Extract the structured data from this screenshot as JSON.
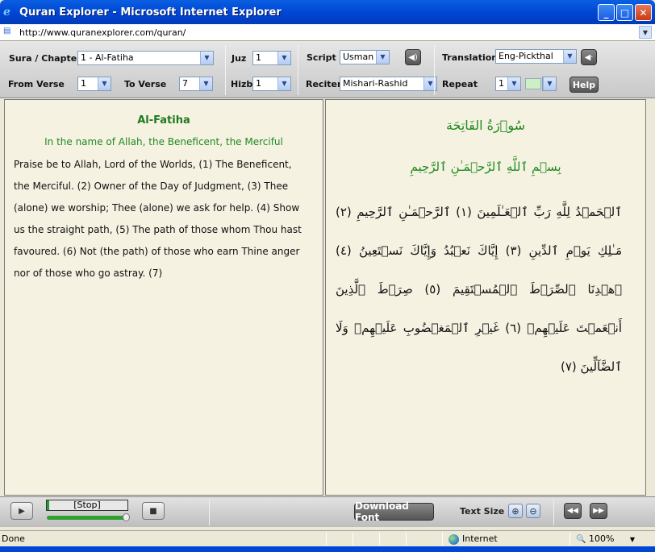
{
  "window": {
    "title": "Quran Explorer - Microsoft Internet Explorer",
    "min_label": "_",
    "max_label": "□",
    "close_label": "✕"
  },
  "address": {
    "url": "http://www.quranexplorer.com/quran/"
  },
  "controls": {
    "sura_label": "Sura / Chapter",
    "sura_value": "1 - Al-Fatiha",
    "juz_label": "Juz",
    "juz_value": "1",
    "script_label": "Script",
    "script_value": "Usmani",
    "translation_label": "Translation",
    "translation_value": "Eng-Pickthal",
    "from_verse_label": "From Verse",
    "from_verse_value": "1",
    "to_verse_label": "To Verse",
    "to_verse_value": "7",
    "hizb_label": "Hizb",
    "hizb_value": "1",
    "reciter_label": "Reciter",
    "reciter_value": "Mishari-Rashid",
    "repeat_label": "Repeat",
    "repeat_value": "1",
    "help_label": "Help",
    "highlight_color": "#CDEFC6"
  },
  "translation_panel": {
    "sura_title": "Al-Fatiha",
    "bismillah": "In the name of Allah, the Beneficent, the Merciful",
    "text": "Praise be to Allah, Lord of the Worlds, (1) The Beneficent, the Merciful. (2) Owner of the Day of Judgment, (3) Thee (alone) we worship; Thee (alone) we ask for help. (4) Show us the straight path, (5) The path of those whom Thou hast favoured. (6) Not (the path) of those who earn Thine anger nor of those who go astray. (7)"
  },
  "arabic_panel": {
    "sura_title": "سُوۡرَةُ الفَاتِحَة",
    "bismillah": "بِسۡمِ ٱللَّهِ ٱلرَّحۡمَـٰنِ ٱلرَّحِيمِ",
    "text": "ٱلۡحَمۡدُ لِلَّهِ رَبِّ ٱلۡعَـٰلَمِينَ (١) ٱلرَّحۡمَـٰنِ ٱلرَّحِيمِ (٢) مَـٰلِكِ يَوۡمِ ٱلدِّينِ (٣) إِيَّاكَ نَعۡبُدُ وَإِيَّاكَ نَسۡتَعِينُ (٤) ٱهۡدِنَا ٱلصِّرَٲطَ ٱلۡمُسۡتَقِيمَ (٥) صِرَٲطَ ٱلَّذِينَ أَنۡعَمۡتَ عَلَيۡهِمۡ (٦) غَيۡرِ ٱلۡمَغۡضُوبِ عَلَيۡهِمۡ وَلَا ٱلضَّآلِّينَ (٧)"
  },
  "player": {
    "status": "[Stop]",
    "progress": 1.0,
    "download_font_label": "Download Font",
    "text_size_label": "Text Size"
  },
  "statusbar": {
    "left": "Done",
    "zone": "Internet",
    "zoom": "100%"
  }
}
